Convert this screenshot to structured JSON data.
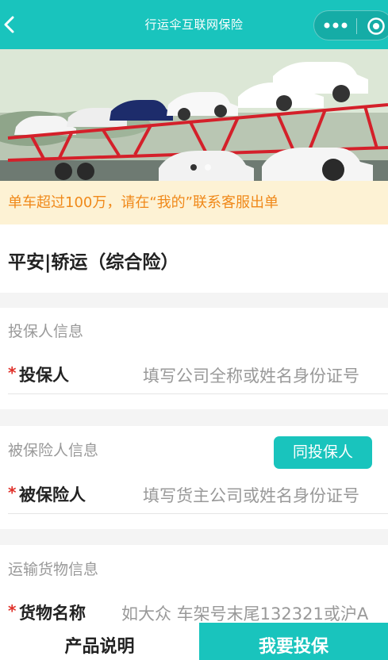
{
  "nav": {
    "title": "行运伞互联网保险"
  },
  "notice": {
    "text": "单车超过100万，请在“我的”联系客服出单"
  },
  "product": {
    "name": "平安|轿运（综合险）"
  },
  "applicant": {
    "section_title": "投保人信息",
    "required_mark": "*",
    "label": "投保人",
    "placeholder": "填写公司全称或姓名身份证号"
  },
  "insured": {
    "section_title": "被保险人信息",
    "same_button": "同投保人",
    "required_mark": "*",
    "label": "被保险人",
    "placeholder": "填写货主公司或姓名身份证号"
  },
  "cargo": {
    "section_title": "运输货物信息",
    "required_mark": "*",
    "label": "货物名称",
    "placeholder": "如大众 车架号末尾132321或沪A"
  },
  "footer": {
    "description_button": "产品说明",
    "buy_button": "我要投保"
  },
  "colors": {
    "brand": "#19c4bd",
    "notice_bg": "#fdf2d4",
    "notice_text": "#f0891a",
    "required": "#e0312a"
  }
}
